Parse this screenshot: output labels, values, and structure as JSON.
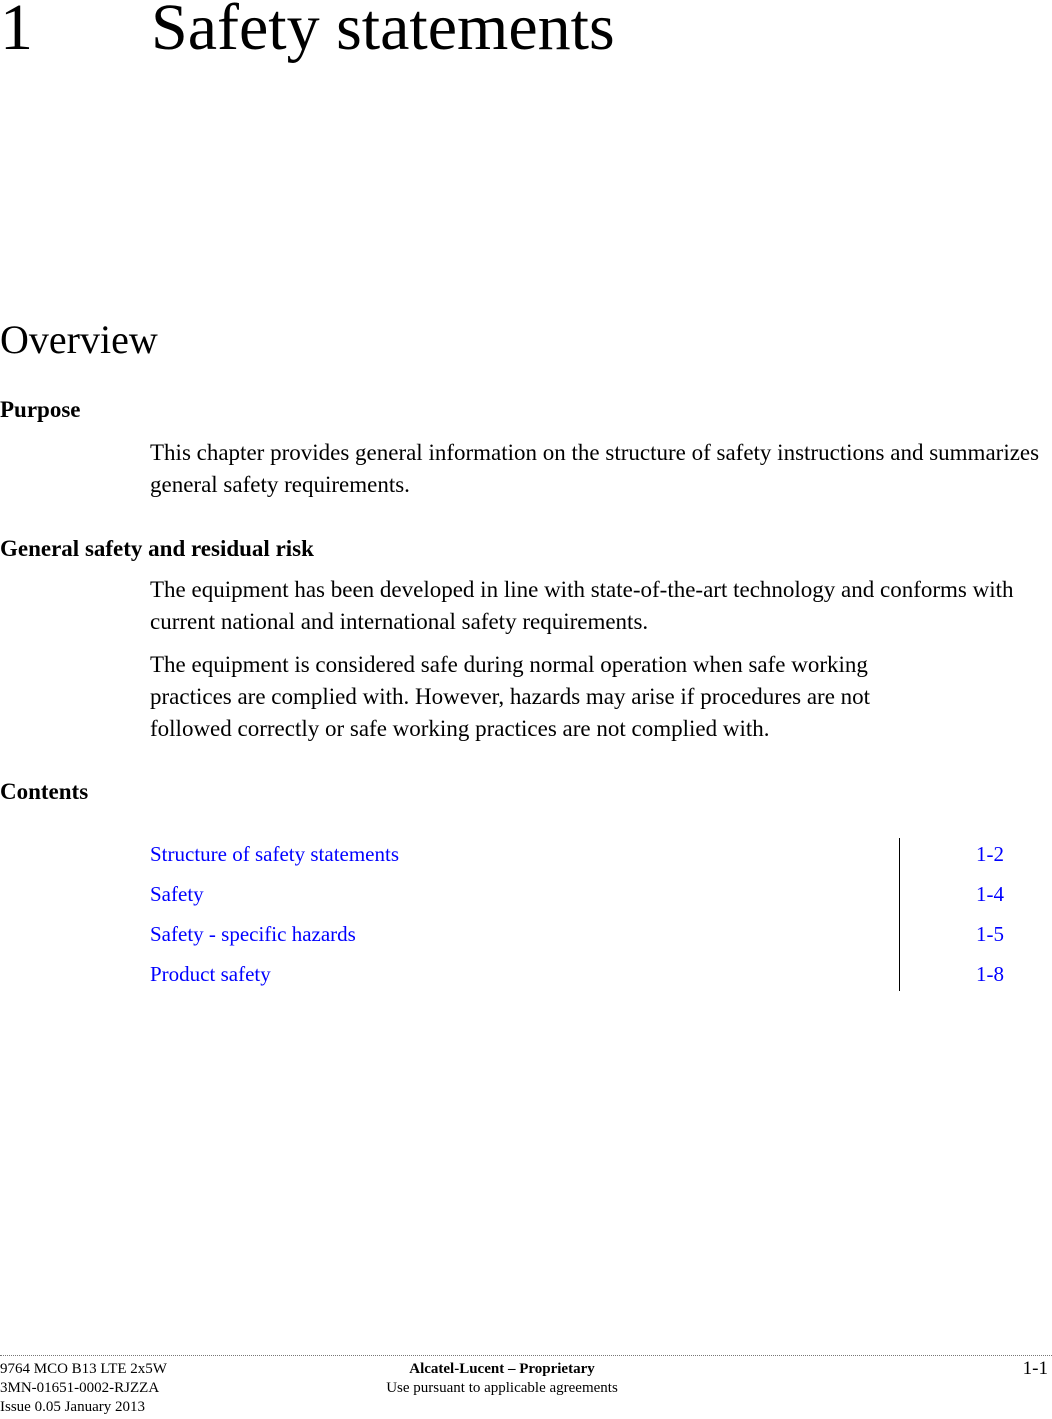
{
  "chapter": {
    "number": "1",
    "title": "Safety statements"
  },
  "overview": {
    "heading": "Overview"
  },
  "sections": {
    "purpose": {
      "heading": "Purpose",
      "paragraphs": [
        "This chapter provides general information on the structure of safety instructions and summarizes general safety requirements."
      ]
    },
    "general_safety": {
      "heading": "General safety and residual risk",
      "paragraphs": [
        "The equipment has been developed in line with state-of-the-art technology and conforms with current national and international safety requirements.",
        "The equipment is considered safe during normal operation when safe working practices are complied with. However, hazards may arise if procedures are not followed correctly or safe working practices are not complied with."
      ]
    },
    "contents": {
      "heading": "Contents",
      "link_color": "#0000ff",
      "items": [
        {
          "title": "Structure of safety statements",
          "page": "1-2"
        },
        {
          "title": "Safety",
          "page": "1-4"
        },
        {
          "title": "Safety - specific hazards",
          "page": "1-5"
        },
        {
          "title": "Product safety",
          "page": "1-8"
        }
      ]
    }
  },
  "footer": {
    "product": "9764 MCO B13 LTE 2x5W",
    "doc_number": "3MN-01651-0002-RJZZA",
    "issue": "Issue 0.05 January 2013",
    "proprietary": "Alcatel-Lucent – Proprietary",
    "usage_note": "Use pursuant to applicable agreements",
    "page_number": "1-1"
  }
}
